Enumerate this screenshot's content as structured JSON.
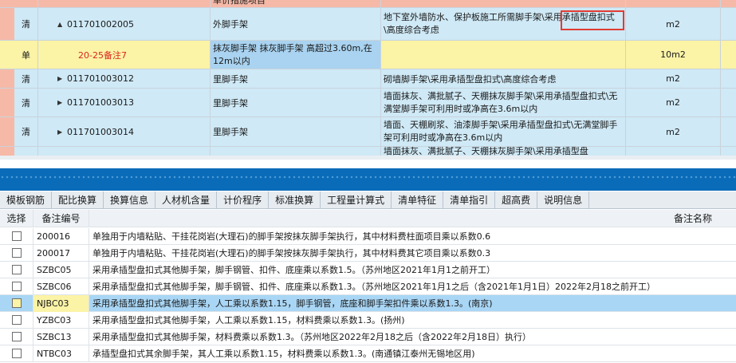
{
  "top_grid": {
    "header_partial": "单价措施项目",
    "rows": [
      {
        "type": "清",
        "code": "011701002005",
        "expander": "▲",
        "name": "外脚手架",
        "desc": "地下室外墙防水、保护板施工所需脚手架\\采用承插型盘扣式\\高度综合考虑",
        "unit": "m2"
      },
      {
        "type": "单",
        "code": "20-25备注7",
        "name": "抹灰脚手架 抹灰脚手架 高超过3.60m,在12m以内",
        "desc": "",
        "unit": "10m2"
      },
      {
        "type": "清",
        "code": "011701003012",
        "expander": "▶",
        "name": "里脚手架",
        "desc": "砌墙脚手架\\采用承插型盘扣式\\高度综合考虑",
        "unit": "m2"
      },
      {
        "type": "清",
        "code": "011701003013",
        "expander": "▶",
        "name": "里脚手架",
        "desc": "墙面抹灰、满批腻子、天棚抹灰脚手架\\采用承插型盘扣式\\无满堂脚手架可利用时或净高在3.6m以内",
        "unit": "m2"
      },
      {
        "type": "清",
        "code": "011701003014",
        "expander": "▶",
        "name": "里脚手架",
        "desc": "墙面、天棚刷浆、油漆脚手架\\采用承插型盘扣式\\无满堂脚手架可利用时或净高在3.6m以内",
        "unit": "m2"
      },
      {
        "type": "",
        "code": "",
        "name": "",
        "desc": "墙面抹灰、满批腻子、天棚抹灰脚手架\\采用承插型盘",
        "unit": ""
      }
    ]
  },
  "tabs": [
    "模板钢筋",
    "配比换算",
    "换算信息",
    "人材机含量",
    "计价程序",
    "标准换算",
    "工程量计算式",
    "清单特征",
    "清单指引",
    "超高费",
    "说明信息"
  ],
  "bottom_table": {
    "headers": {
      "select": "选择",
      "code": "备注编号",
      "name": "备注名称"
    },
    "rows": [
      {
        "code": "200016",
        "name": "单独用于内墙粘贴、干挂花岗岩(大理石)的脚手架按抹灰脚手架执行，其中材料费柱面项目乘以系数0.6",
        "checked": false
      },
      {
        "code": "200017",
        "name": "单独用于内墙粘贴、干挂花岗岩(大理石)的脚手架按抹灰脚手架执行，其中材料费其它项目乘以系数0.3",
        "checked": false
      },
      {
        "code": "SZBC05",
        "name": "采用承插型盘扣式其他脚手架，脚手钢管、扣件、底座乘以系数1.5。（苏州地区2021年1月1之前开工）",
        "checked": false
      },
      {
        "code": "SZBC06",
        "name": "采用承插型盘扣式其他脚手架，脚手钢管、扣件、底座乘以系数1.3。（苏州地区2021年1月1之后（含2021年1月1日）2022年2月18之前开工）",
        "checked": false
      },
      {
        "code": "NJBC03",
        "name": "采用承插型盘扣式其他脚手架，人工乘以系数1.15，脚手钢管，底座和脚手架扣件乘以系数1.3。(南京)",
        "checked": false,
        "selected": true
      },
      {
        "code": "YZBC03",
        "name": "采用承插型盘扣式其他脚手架，人工乘以系数1.15，材料费乘以系数1.3。(扬州)",
        "checked": false
      },
      {
        "code": "SZBC13",
        "name": "采用承插型盘扣式其他脚手架，材料费乘以系数1.3。（苏州地区2022年2月18之后（含2022年2月18日）执行）",
        "checked": false
      },
      {
        "code": "NTBC03",
        "name": "承插型盘扣式其余脚手架，其人工乘以系数1.15，材料费乘以系数1.3。(南通镇江泰州无锡地区用)",
        "checked": false
      }
    ]
  },
  "colors": {
    "header_salmon": "#f6b9a7",
    "row_blue": "#cfe9f6",
    "row_yellow": "#fbf3a6",
    "selected_blue": "#a9d6f5",
    "splitter_blue": "#0a6bb8",
    "highlight_red": "#e23b33"
  }
}
